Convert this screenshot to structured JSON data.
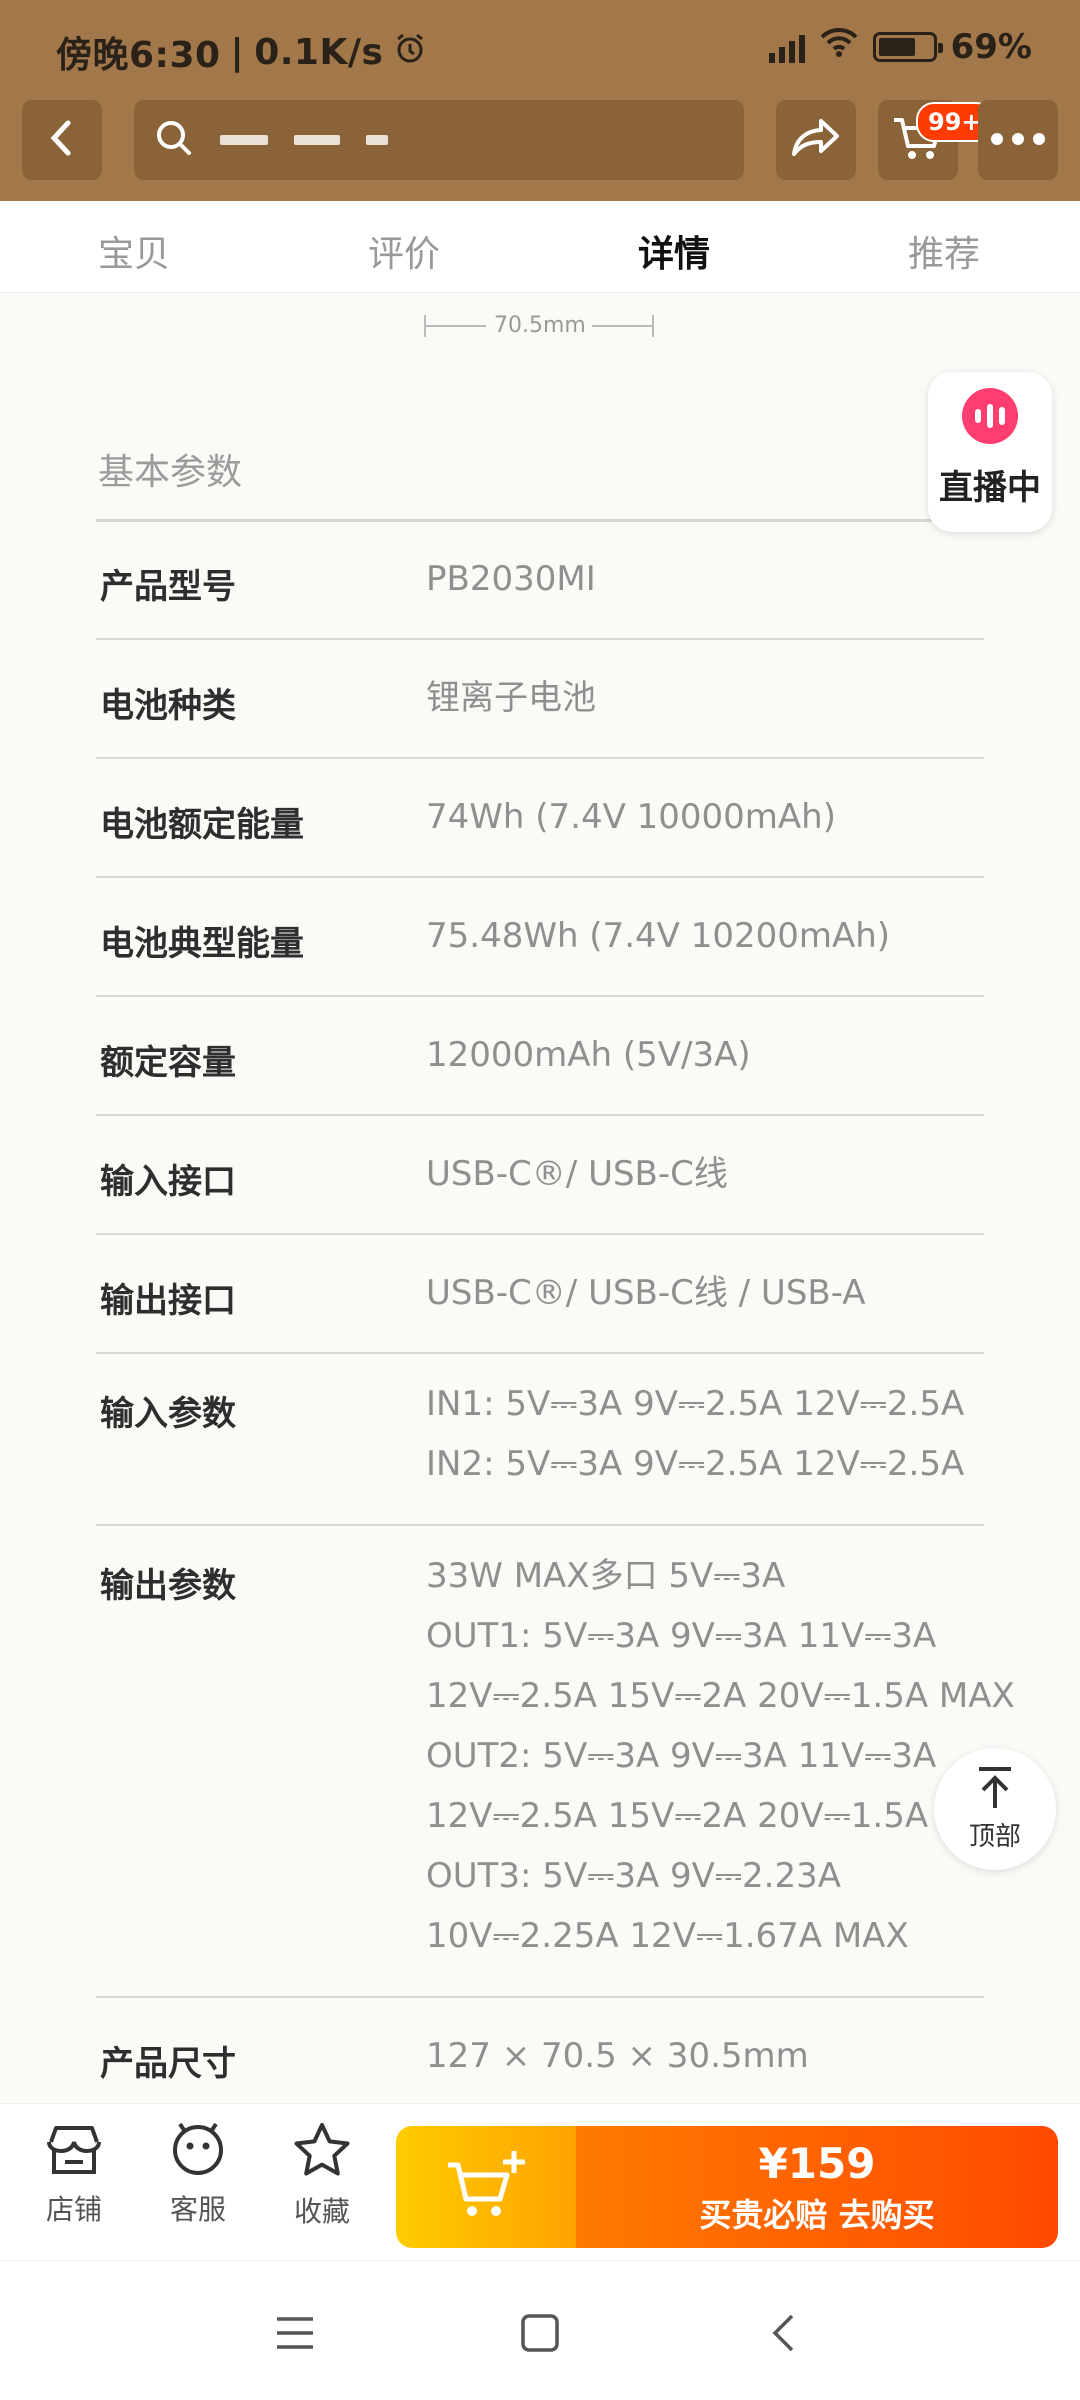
{
  "status": {
    "time": "傍晚6:30",
    "speed": "0.1K/s",
    "battery": "69%",
    "battery_level": 0.69
  },
  "header": {
    "cart_badge": "99+"
  },
  "tabs": [
    {
      "label": "宝贝",
      "active": false
    },
    {
      "label": "评价",
      "active": false
    },
    {
      "label": "详情",
      "active": true
    },
    {
      "label": "推荐",
      "active": false
    }
  ],
  "content": {
    "dimension_top": "70.5mm",
    "section_title": "基本参数",
    "specs": [
      {
        "label": "产品型号",
        "lines": [
          "PB2030MI"
        ]
      },
      {
        "label": "电池种类",
        "lines": [
          "锂离子电池"
        ]
      },
      {
        "label": "电池额定能量",
        "lines": [
          "74Wh (7.4V 10000mAh)"
        ]
      },
      {
        "label": "电池典型能量",
        "lines": [
          "75.48Wh (7.4V 10200mAh)"
        ]
      },
      {
        "label": "额定容量",
        "lines": [
          "12000mAh (5V/3A)"
        ]
      },
      {
        "label": "输入接口",
        "lines": [
          "USB-C®/ USB-C线"
        ]
      },
      {
        "label": "输出接口",
        "lines": [
          "USB-C®/ USB-C线 / USB-A"
        ]
      },
      {
        "label": "输入参数",
        "lines": [
          "IN1: 5V⎓3A 9V⎓2.5A 12V⎓2.5A",
          "IN2: 5V⎓3A 9V⎓2.5A 12V⎓2.5A"
        ]
      },
      {
        "label": "输出参数",
        "lines": [
          "33W MAX多口 5V⎓3A",
          "OUT1: 5V⎓3A 9V⎓3A 11V⎓3A",
          "12V⎓2.5A 15V⎓2A 20V⎓1.5A MAX",
          "OUT2: 5V⎓3A 9V⎓3A 11V⎓3A",
          "12V⎓2.5A 15V⎓2A 20V⎓1.5A MAX",
          "OUT3: 5V⎓3A 9V⎓2.23A",
          "10V⎓2.25A 12V⎓1.67A MAX"
        ]
      },
      {
        "label": "产品尺寸",
        "lines": [
          "127 × 70.5 × 30.5mm"
        ]
      }
    ]
  },
  "floating": {
    "live_label": "直播中",
    "top_label": "顶部"
  },
  "bottom": {
    "shop": "店铺",
    "service": "客服",
    "favorite": "收藏",
    "price": "¥159",
    "buy_label": "买贵必赔  去购买"
  }
}
